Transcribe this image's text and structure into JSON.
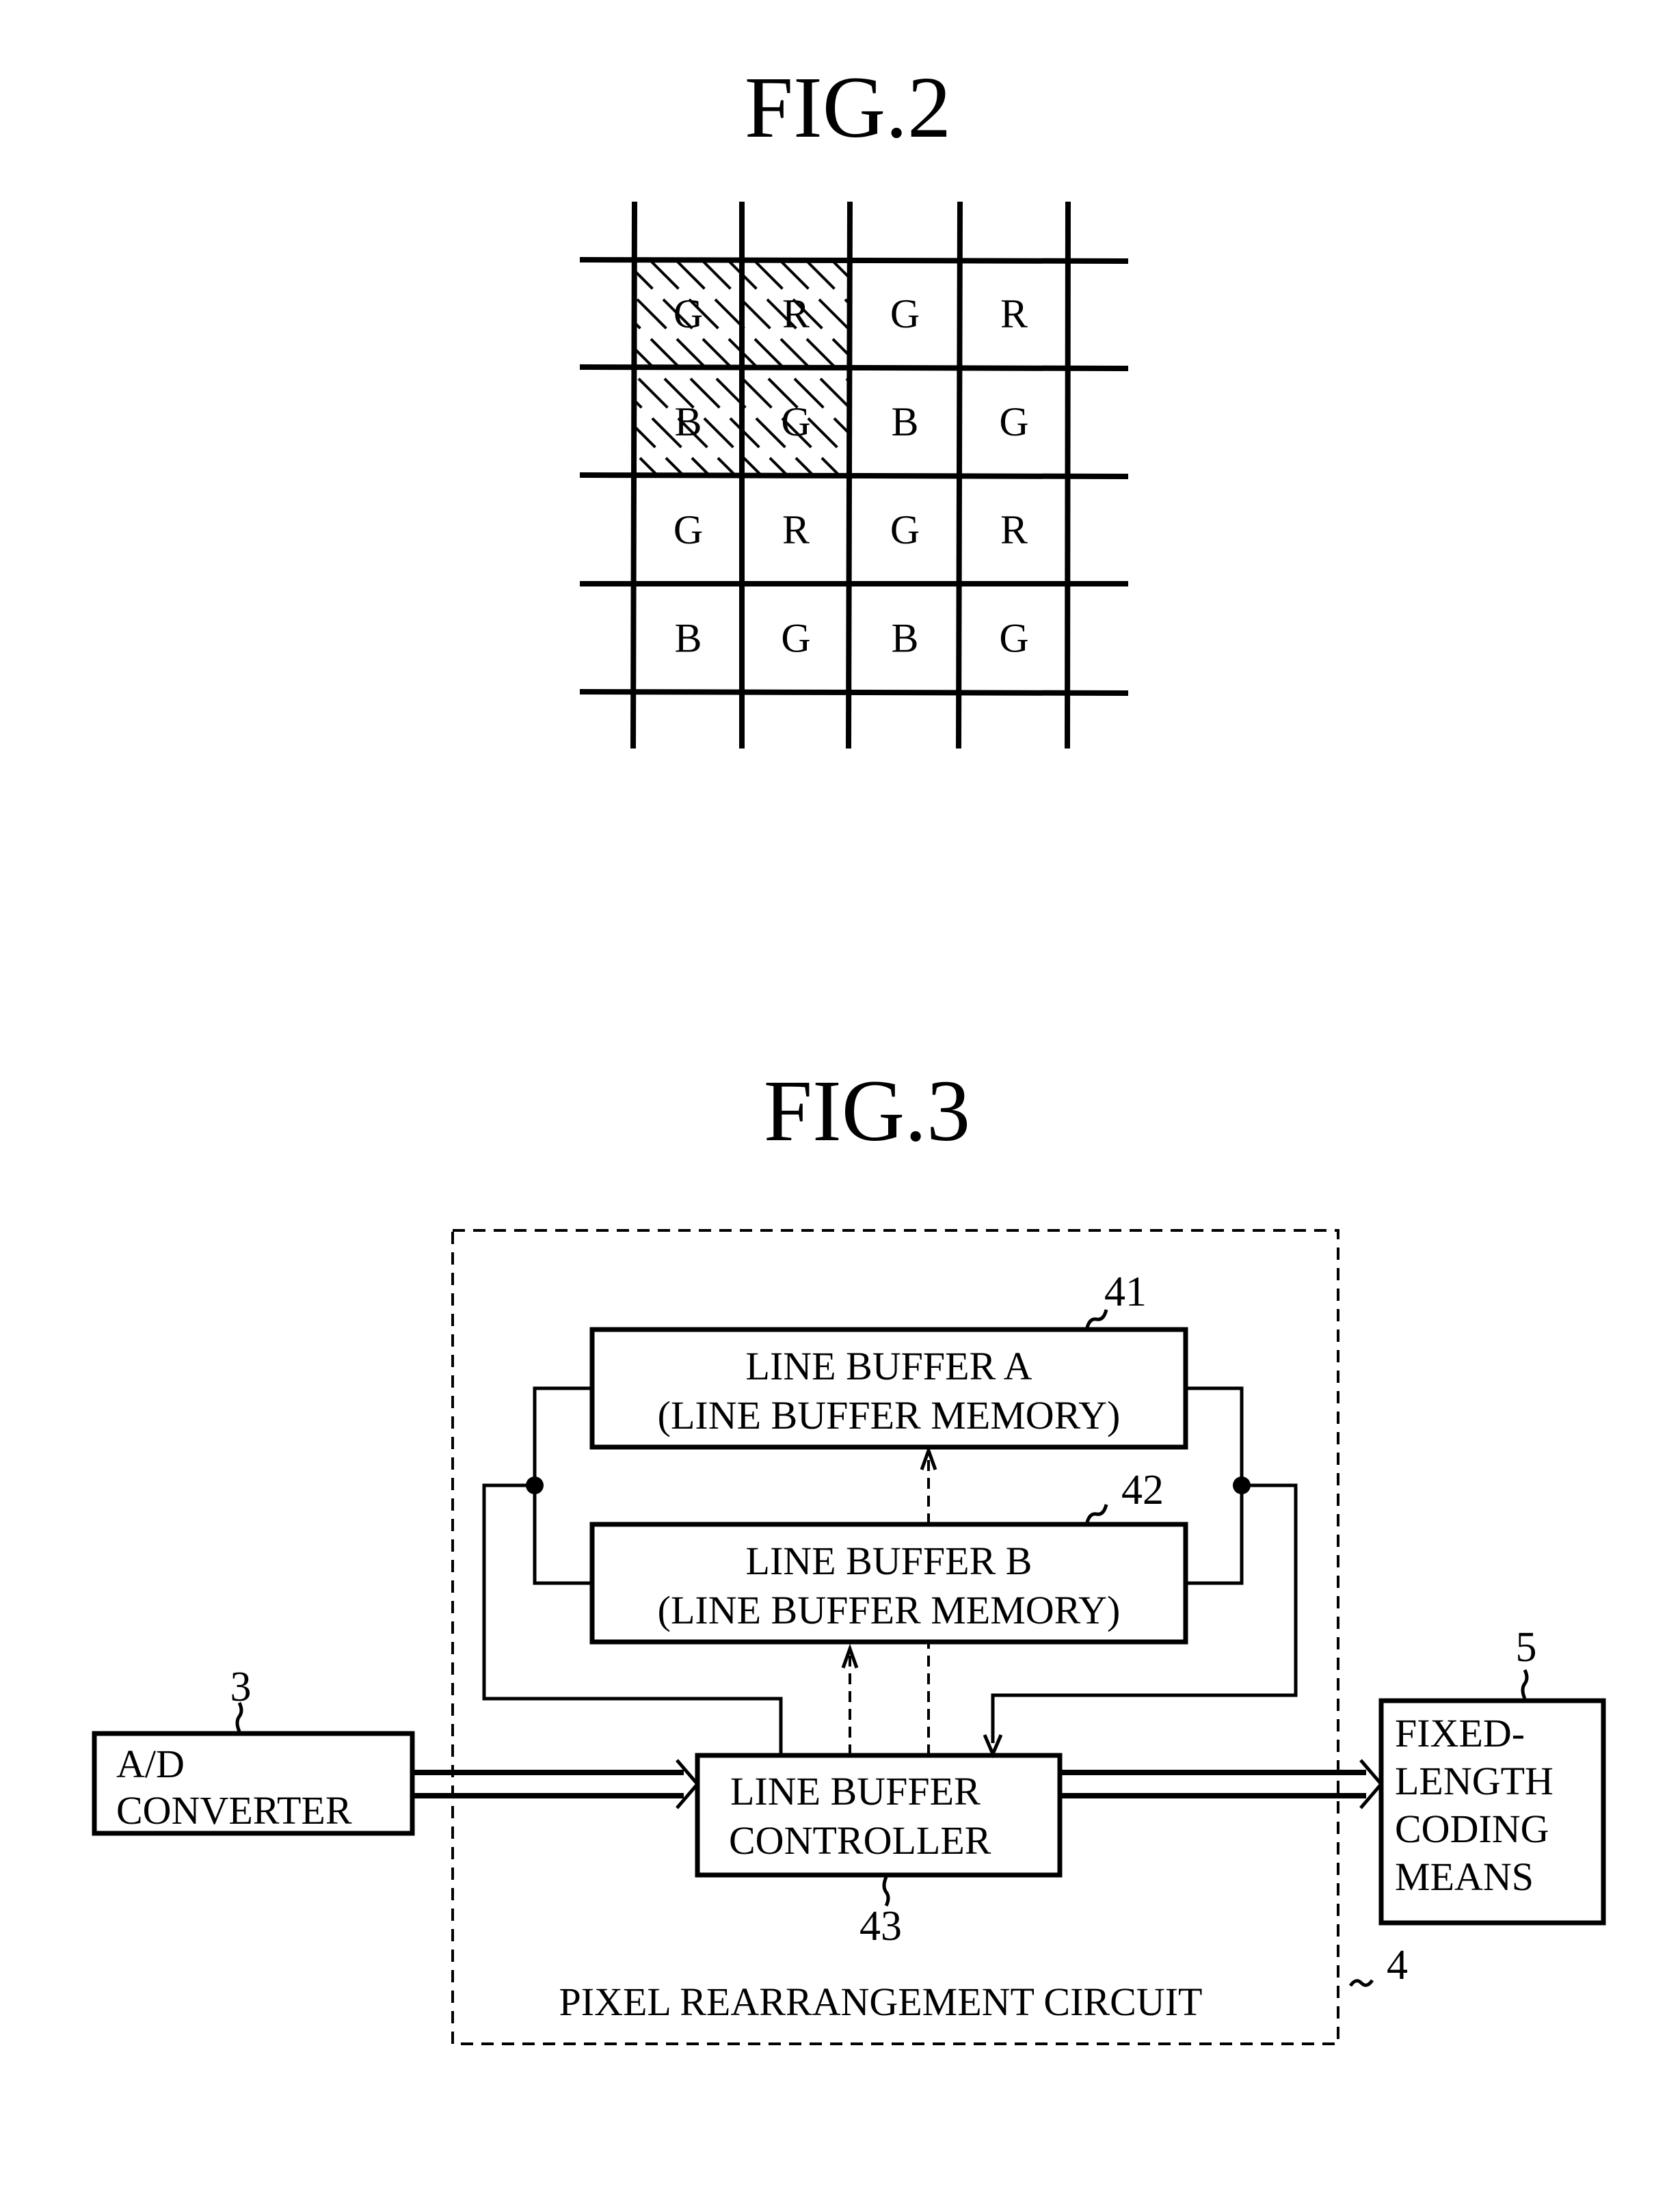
{
  "fig2": {
    "title": "FIG.2",
    "grid": [
      [
        "G",
        "R",
        "G",
        "R"
      ],
      [
        "B",
        "G",
        "B",
        "G"
      ],
      [
        "G",
        "R",
        "G",
        "R"
      ],
      [
        "B",
        "G",
        "B",
        "G"
      ]
    ],
    "hatched_cells": [
      [
        0,
        0
      ],
      [
        0,
        1
      ],
      [
        1,
        0
      ],
      [
        1,
        1
      ]
    ]
  },
  "fig3": {
    "title": "FIG.3",
    "circuit_label": "PIXEL REARRANGEMENT CIRCUIT",
    "circuit_ref": "4",
    "line_buffer_a": {
      "line1": "LINE BUFFER A",
      "line2": "(LINE BUFFER MEMORY)",
      "ref": "41"
    },
    "line_buffer_b": {
      "line1": "LINE BUFFER B",
      "line2": "(LINE BUFFER MEMORY)",
      "ref": "42"
    },
    "controller": {
      "line1": "LINE BUFFER",
      "line2": "CONTROLLER",
      "ref": "43"
    },
    "ad_converter": {
      "line1": "A/D",
      "line2": "CONVERTER",
      "ref": "3"
    },
    "coding": {
      "line1": "FIXED-",
      "line2": "LENGTH",
      "line3": "CODING",
      "line4": "MEANS",
      "ref": "5"
    }
  }
}
